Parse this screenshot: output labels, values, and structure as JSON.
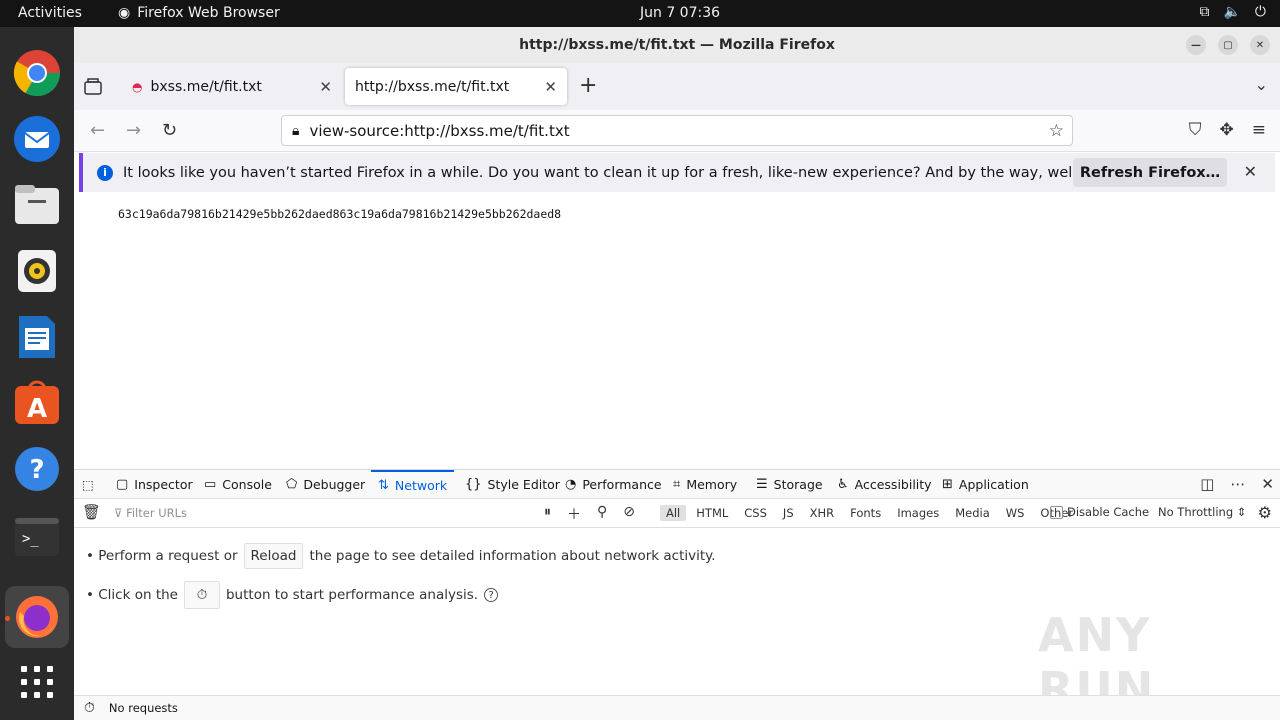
{
  "topbar": {
    "activities": "Activities",
    "app_name": "Firefox Web Browser",
    "clock": "Jun 7  07:36"
  },
  "window": {
    "title": "http://bxss.me/t/fit.txt — Mozilla Firefox"
  },
  "tabs": [
    {
      "label": "bxss.me/t/fit.txt",
      "active": false
    },
    {
      "label": "http://bxss.me/t/fit.txt",
      "active": true
    }
  ],
  "urlbar": {
    "value": "view-source:http://bxss.me/t/fit.txt"
  },
  "notification": {
    "message": "It looks like you haven’t started Firefox in a while. Do you want to clean it up for a fresh, like-new experience? And by the way, welcome back!",
    "button": "Refresh Firefox…"
  },
  "page": {
    "source_text": "63c19a6da79816b21429e5bb262daed863c19a6da79816b21429e5bb262daed8"
  },
  "devtools": {
    "tabs": [
      {
        "label": "Inspector",
        "icon": "inspector-icon"
      },
      {
        "label": "Console",
        "icon": "console-icon"
      },
      {
        "label": "Debugger",
        "icon": "debugger-icon"
      },
      {
        "label": "Network",
        "icon": "network-icon"
      },
      {
        "label": "Style Editor",
        "icon": "style-editor-icon"
      },
      {
        "label": "Performance",
        "icon": "performance-icon"
      },
      {
        "label": "Memory",
        "icon": "memory-icon"
      },
      {
        "label": "Storage",
        "icon": "storage-icon"
      },
      {
        "label": "Accessibility",
        "icon": "accessibility-icon"
      },
      {
        "label": "Application",
        "icon": "application-icon"
      }
    ],
    "selected_tab": "Network",
    "filter_placeholder": "Filter URLs",
    "types": [
      "All",
      "HTML",
      "CSS",
      "JS",
      "XHR",
      "Fonts",
      "Images",
      "Media",
      "WS",
      "Other"
    ],
    "disable_cache": "Disable Cache",
    "throttling": "No Throttling ⇕",
    "msg1_before": "• Perform a request or",
    "msg1_button": "Reload",
    "msg1_after": "the page to see detailed information about network activity.",
    "msg2_before": "• Click on the",
    "msg2_after": "button to start performance analysis.",
    "status": "No requests",
    "watermark": "ANY RUN"
  },
  "colors": {
    "accent": "#0060df",
    "notif_bar": "#7542e5",
    "dock_indicator": "#e95420"
  }
}
